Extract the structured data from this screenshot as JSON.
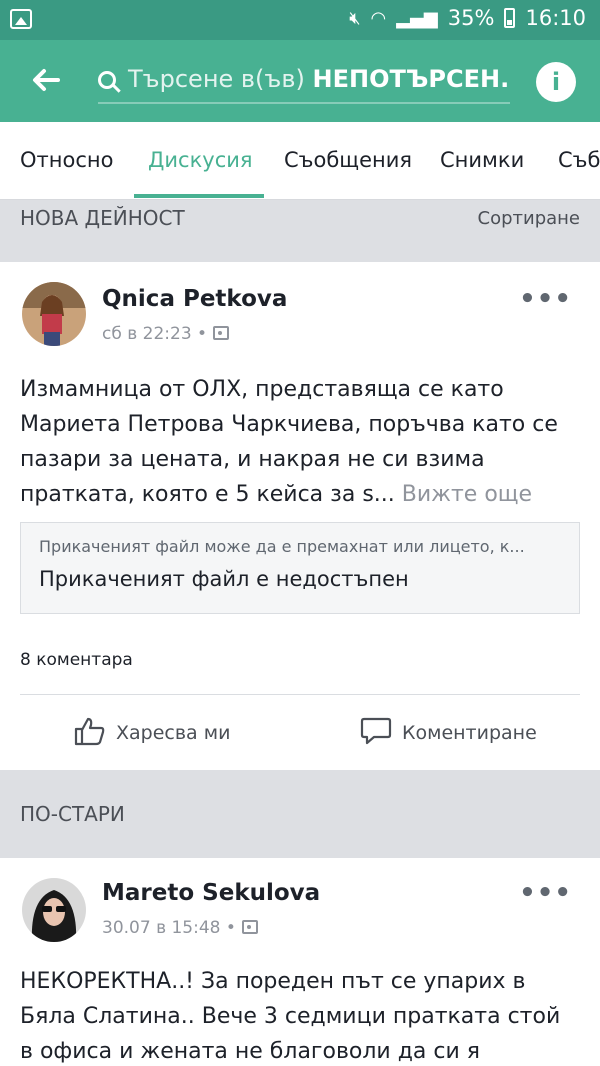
{
  "status_bar": {
    "battery": "35%",
    "time": "16:10"
  },
  "app_bar": {
    "search_placeholder": "Търсене в(ъв)",
    "search_query": "НЕПОТЪРСЕН..."
  },
  "tabs": [
    {
      "label": "Относно"
    },
    {
      "label": "Дискусия"
    },
    {
      "label": "Съобщения"
    },
    {
      "label": "Снимки"
    },
    {
      "label": "Съби"
    }
  ],
  "active_tab": "Дискусия",
  "new_activity": {
    "title": "НОВА ДЕЙНОСТ",
    "sort_label": "Сортиране"
  },
  "post1": {
    "author": "Qnica Petkova",
    "time": "сб в 22:23 •",
    "text": "Измамница от ОЛХ, представяща се като Мариета Петрова Чаркчиева, поръчва като се пазари за цената, и накрая не си взима пратката, която е 5 кейса за s...",
    "see_more": "Вижте още",
    "attachment_sub": "Прикаченият файл може да е премахнат или лицето, к...",
    "attachment_main": "Прикаченият файл е недостъпен",
    "comments": "8 коментара",
    "like_label": "Харесва ми",
    "comment_label": "Коментиране"
  },
  "older": {
    "title": "ПО-СТАРИ"
  },
  "post2": {
    "author": "Mareto Sekulova",
    "time": "30.07 в 15:48 •",
    "text": "НЕКОРЕКТНА..! За пореден път се упарих в Бяла Слатина.. Вече 3 седмици пратката стой в офиса и жената не благоволи да си я"
  }
}
